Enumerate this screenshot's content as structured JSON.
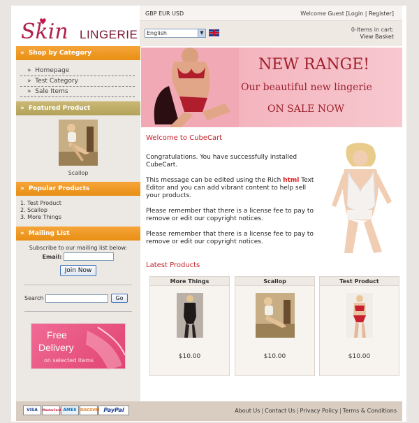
{
  "logo": {
    "skin": "Skin",
    "lingerie": "LINGERIE"
  },
  "header": {
    "currencies": [
      "GBP",
      "EUR",
      "USD"
    ],
    "welcome_prefix": "Welcome Guest [",
    "login": "Login",
    "divider": " | ",
    "register": "Register",
    "welcome_suffix": "]",
    "language": "English",
    "cart_count": "0-Items in cart:",
    "view_basket": "View Basket"
  },
  "sidebar": {
    "category_heading": "Shop by Category",
    "categories": [
      "Homepage",
      "Test Category",
      "Sale Items"
    ],
    "featured_heading": "Featured Product",
    "featured_caption": "Scallop",
    "popular_heading": "Popular Products",
    "popular": [
      "1. Test Product",
      "2. Scallop",
      "3. More Things"
    ],
    "mailing_heading": "Mailing List",
    "subscribe_text": "Subscribe to our mailing list below:",
    "email_label": "Email:",
    "join_label": "Join Now",
    "search_label": "Search",
    "go_label": "Go",
    "promo": {
      "free": "Free",
      "delivery": "Delivery",
      "sub": "on selected items"
    }
  },
  "banner": {
    "line1": "NEW RANGE!",
    "line2": "Our beautiful new lingerie",
    "line3": "ON SALE NOW"
  },
  "content": {
    "welcome_title": "Welcome to CubeCart",
    "para1": "Congratulations. You have successfully installed CubeCart.",
    "para2_before": "This message can be edited using the Rich ",
    "para2_html": "html",
    "para2_after": " Text Editor and you can add vibrant content to help sell your products.",
    "para3": "Please remember that there is a license fee to pay to remove or edit our copyright notices.",
    "para4": "Please remember that there is a license fee to pay to remove or edit our copyright notices.",
    "latest_title": "Latest Products"
  },
  "products": [
    {
      "name": "More Things",
      "price": "$10.00"
    },
    {
      "name": "Scallop",
      "price": "$10.00"
    },
    {
      "name": "Test Product",
      "price": "$10.00"
    }
  ],
  "footer": {
    "cards": [
      "VISA",
      "MasterCard",
      "AMEX",
      "DISCOVER",
      "PayPal"
    ],
    "links": [
      "About Us",
      "Contact Us",
      "Privacy Policy",
      "Terms & Conditions"
    ],
    "sep": "|"
  },
  "colors": {
    "accent_orange": "#e88f14",
    "accent_red": "#c6242b",
    "olive": "#b3a25a"
  }
}
